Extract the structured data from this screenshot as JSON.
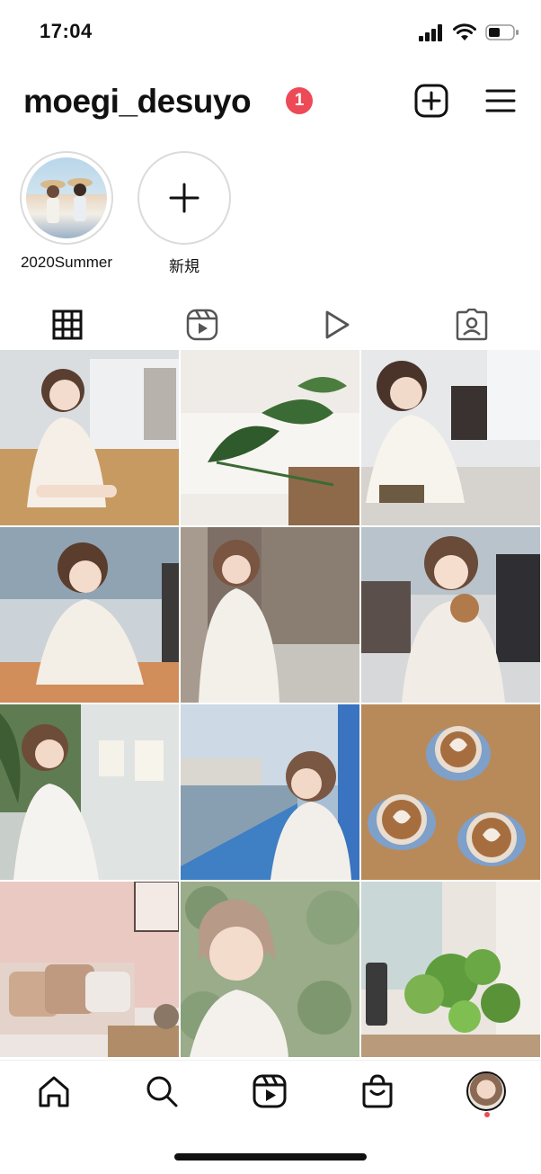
{
  "status_bar": {
    "time": "17:04",
    "icons": [
      "cellular-signal-icon",
      "wifi-icon",
      "battery-icon"
    ]
  },
  "header": {
    "username": "moegi_desuyo",
    "notification_count": "1",
    "actions": [
      "new-post-icon",
      "menu-icon"
    ]
  },
  "highlights": [
    {
      "label": "2020Summer",
      "kind": "story-highlight"
    },
    {
      "label": "新規",
      "kind": "new-highlight"
    }
  ],
  "tabs": [
    {
      "name": "posts-grid",
      "icon": "grid-icon",
      "active": true
    },
    {
      "name": "reels",
      "icon": "reels-icon",
      "active": false
    },
    {
      "name": "igtv",
      "icon": "play-icon",
      "active": false
    },
    {
      "name": "tagged",
      "icon": "tagged-person-icon",
      "active": false
    }
  ],
  "posts": [
    {
      "subject": "portrait at office table"
    },
    {
      "subject": "monstera plant on sofa"
    },
    {
      "subject": "portrait at cafe table"
    },
    {
      "subject": "portrait by window"
    },
    {
      "subject": "portrait against wooden wall"
    },
    {
      "subject": "holding bread at cafe"
    },
    {
      "subject": "portrait with tote bags"
    },
    {
      "subject": "portrait by the river"
    },
    {
      "subject": "latte art coffees"
    },
    {
      "subject": "pink bedroom interior"
    },
    {
      "subject": "selfie against ivy"
    },
    {
      "subject": "pothos plant by window"
    }
  ],
  "colors": {
    "badge": "#ed4956",
    "text": "#111111",
    "ring": "#dbdbdb"
  },
  "bottom_nav": [
    "home-icon",
    "search-icon",
    "reels-icon",
    "shop-icon",
    "profile-avatar"
  ]
}
